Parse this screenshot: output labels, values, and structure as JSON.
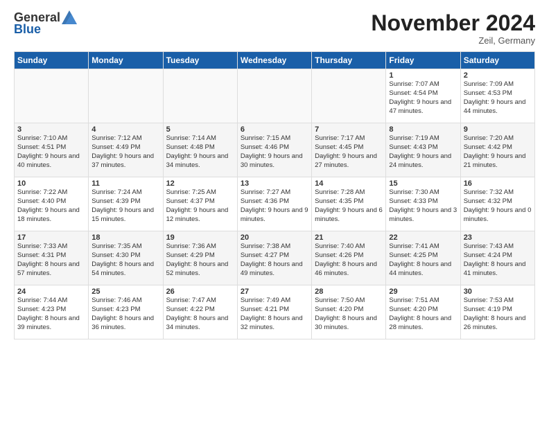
{
  "header": {
    "logo_general": "General",
    "logo_blue": "Blue",
    "title": "November 2024",
    "location": "Zeil, Germany"
  },
  "weekdays": [
    "Sunday",
    "Monday",
    "Tuesday",
    "Wednesday",
    "Thursday",
    "Friday",
    "Saturday"
  ],
  "weeks": [
    [
      {
        "day": "",
        "empty": true
      },
      {
        "day": "",
        "empty": true
      },
      {
        "day": "",
        "empty": true
      },
      {
        "day": "",
        "empty": true
      },
      {
        "day": "",
        "empty": true
      },
      {
        "day": "1",
        "sunrise": "Sunrise: 7:07 AM",
        "sunset": "Sunset: 4:54 PM",
        "daylight": "Daylight: 9 hours and 47 minutes."
      },
      {
        "day": "2",
        "sunrise": "Sunrise: 7:09 AM",
        "sunset": "Sunset: 4:53 PM",
        "daylight": "Daylight: 9 hours and 44 minutes."
      }
    ],
    [
      {
        "day": "3",
        "sunrise": "Sunrise: 7:10 AM",
        "sunset": "Sunset: 4:51 PM",
        "daylight": "Daylight: 9 hours and 40 minutes."
      },
      {
        "day": "4",
        "sunrise": "Sunrise: 7:12 AM",
        "sunset": "Sunset: 4:49 PM",
        "daylight": "Daylight: 9 hours and 37 minutes."
      },
      {
        "day": "5",
        "sunrise": "Sunrise: 7:14 AM",
        "sunset": "Sunset: 4:48 PM",
        "daylight": "Daylight: 9 hours and 34 minutes."
      },
      {
        "day": "6",
        "sunrise": "Sunrise: 7:15 AM",
        "sunset": "Sunset: 4:46 PM",
        "daylight": "Daylight: 9 hours and 30 minutes."
      },
      {
        "day": "7",
        "sunrise": "Sunrise: 7:17 AM",
        "sunset": "Sunset: 4:45 PM",
        "daylight": "Daylight: 9 hours and 27 minutes."
      },
      {
        "day": "8",
        "sunrise": "Sunrise: 7:19 AM",
        "sunset": "Sunset: 4:43 PM",
        "daylight": "Daylight: 9 hours and 24 minutes."
      },
      {
        "day": "9",
        "sunrise": "Sunrise: 7:20 AM",
        "sunset": "Sunset: 4:42 PM",
        "daylight": "Daylight: 9 hours and 21 minutes."
      }
    ],
    [
      {
        "day": "10",
        "sunrise": "Sunrise: 7:22 AM",
        "sunset": "Sunset: 4:40 PM",
        "daylight": "Daylight: 9 hours and 18 minutes."
      },
      {
        "day": "11",
        "sunrise": "Sunrise: 7:24 AM",
        "sunset": "Sunset: 4:39 PM",
        "daylight": "Daylight: 9 hours and 15 minutes."
      },
      {
        "day": "12",
        "sunrise": "Sunrise: 7:25 AM",
        "sunset": "Sunset: 4:37 PM",
        "daylight": "Daylight: 9 hours and 12 minutes."
      },
      {
        "day": "13",
        "sunrise": "Sunrise: 7:27 AM",
        "sunset": "Sunset: 4:36 PM",
        "daylight": "Daylight: 9 hours and 9 minutes."
      },
      {
        "day": "14",
        "sunrise": "Sunrise: 7:28 AM",
        "sunset": "Sunset: 4:35 PM",
        "daylight": "Daylight: 9 hours and 6 minutes."
      },
      {
        "day": "15",
        "sunrise": "Sunrise: 7:30 AM",
        "sunset": "Sunset: 4:33 PM",
        "daylight": "Daylight: 9 hours and 3 minutes."
      },
      {
        "day": "16",
        "sunrise": "Sunrise: 7:32 AM",
        "sunset": "Sunset: 4:32 PM",
        "daylight": "Daylight: 9 hours and 0 minutes."
      }
    ],
    [
      {
        "day": "17",
        "sunrise": "Sunrise: 7:33 AM",
        "sunset": "Sunset: 4:31 PM",
        "daylight": "Daylight: 8 hours and 57 minutes."
      },
      {
        "day": "18",
        "sunrise": "Sunrise: 7:35 AM",
        "sunset": "Sunset: 4:30 PM",
        "daylight": "Daylight: 8 hours and 54 minutes."
      },
      {
        "day": "19",
        "sunrise": "Sunrise: 7:36 AM",
        "sunset": "Sunset: 4:29 PM",
        "daylight": "Daylight: 8 hours and 52 minutes."
      },
      {
        "day": "20",
        "sunrise": "Sunrise: 7:38 AM",
        "sunset": "Sunset: 4:27 PM",
        "daylight": "Daylight: 8 hours and 49 minutes."
      },
      {
        "day": "21",
        "sunrise": "Sunrise: 7:40 AM",
        "sunset": "Sunset: 4:26 PM",
        "daylight": "Daylight: 8 hours and 46 minutes."
      },
      {
        "day": "22",
        "sunrise": "Sunrise: 7:41 AM",
        "sunset": "Sunset: 4:25 PM",
        "daylight": "Daylight: 8 hours and 44 minutes."
      },
      {
        "day": "23",
        "sunrise": "Sunrise: 7:43 AM",
        "sunset": "Sunset: 4:24 PM",
        "daylight": "Daylight: 8 hours and 41 minutes."
      }
    ],
    [
      {
        "day": "24",
        "sunrise": "Sunrise: 7:44 AM",
        "sunset": "Sunset: 4:23 PM",
        "daylight": "Daylight: 8 hours and 39 minutes."
      },
      {
        "day": "25",
        "sunrise": "Sunrise: 7:46 AM",
        "sunset": "Sunset: 4:23 PM",
        "daylight": "Daylight: 8 hours and 36 minutes."
      },
      {
        "day": "26",
        "sunrise": "Sunrise: 7:47 AM",
        "sunset": "Sunset: 4:22 PM",
        "daylight": "Daylight: 8 hours and 34 minutes."
      },
      {
        "day": "27",
        "sunrise": "Sunrise: 7:49 AM",
        "sunset": "Sunset: 4:21 PM",
        "daylight": "Daylight: 8 hours and 32 minutes."
      },
      {
        "day": "28",
        "sunrise": "Sunrise: 7:50 AM",
        "sunset": "Sunset: 4:20 PM",
        "daylight": "Daylight: 8 hours and 30 minutes."
      },
      {
        "day": "29",
        "sunrise": "Sunrise: 7:51 AM",
        "sunset": "Sunset: 4:20 PM",
        "daylight": "Daylight: 8 hours and 28 minutes."
      },
      {
        "day": "30",
        "sunrise": "Sunrise: 7:53 AM",
        "sunset": "Sunset: 4:19 PM",
        "daylight": "Daylight: 8 hours and 26 minutes."
      }
    ]
  ]
}
